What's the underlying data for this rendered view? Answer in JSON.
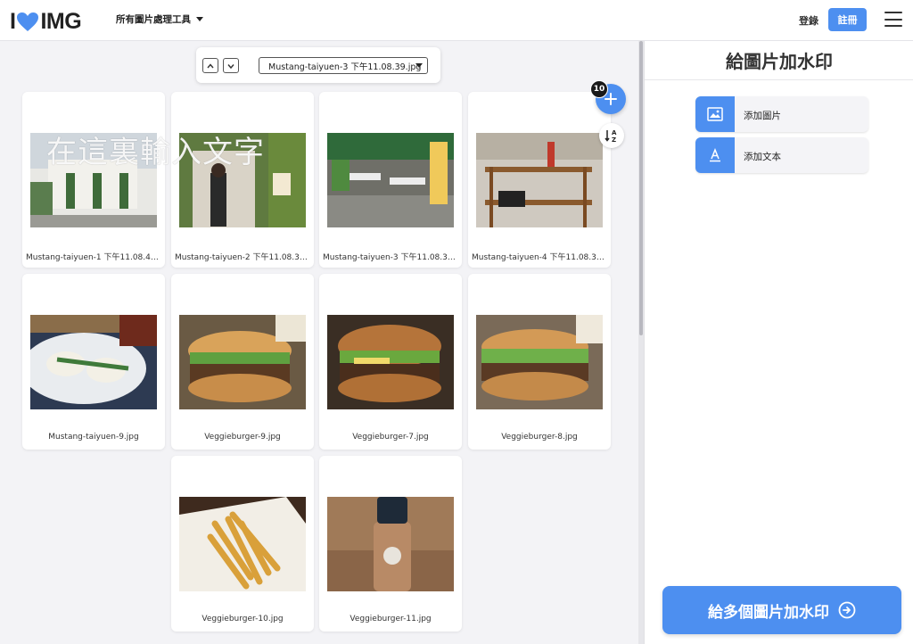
{
  "header": {
    "logo_left": "I",
    "logo_right": "IMG",
    "tools_menu": "所有圖片處理工具",
    "login": "登錄",
    "signup": "註冊"
  },
  "toolbar": {
    "selected_file": "Mustang-taiyuen-3 下午11.08.39.jpg"
  },
  "watermark_text": "在這裏輸入文字",
  "image_count": "10",
  "images": [
    {
      "name": "Mustang-taiyuen-1 下午11.08.41.j..."
    },
    {
      "name": "Mustang-taiyuen-2 下午11.08.39...."
    },
    {
      "name": "Mustang-taiyuen-3 下午11.08.39...."
    },
    {
      "name": "Mustang-taiyuen-4 下午11.08.39...."
    },
    {
      "name": "Mustang-taiyuen-9.jpg"
    },
    {
      "name": "Veggieburger-9.jpg"
    },
    {
      "name": "Veggieburger-7.jpg"
    },
    {
      "name": "Veggieburger-8.jpg"
    },
    {
      "name": "Veggieburger-10.jpg"
    },
    {
      "name": "Veggieburger-11.jpg"
    }
  ],
  "sidebar": {
    "title": "給圖片加水印",
    "add_image": "添加圖片",
    "add_text": "添加文本",
    "apply": "給多個圖片加水印"
  },
  "colors": {
    "accent": "#4d8ff0",
    "brand_heart": "#4d8ff0"
  }
}
